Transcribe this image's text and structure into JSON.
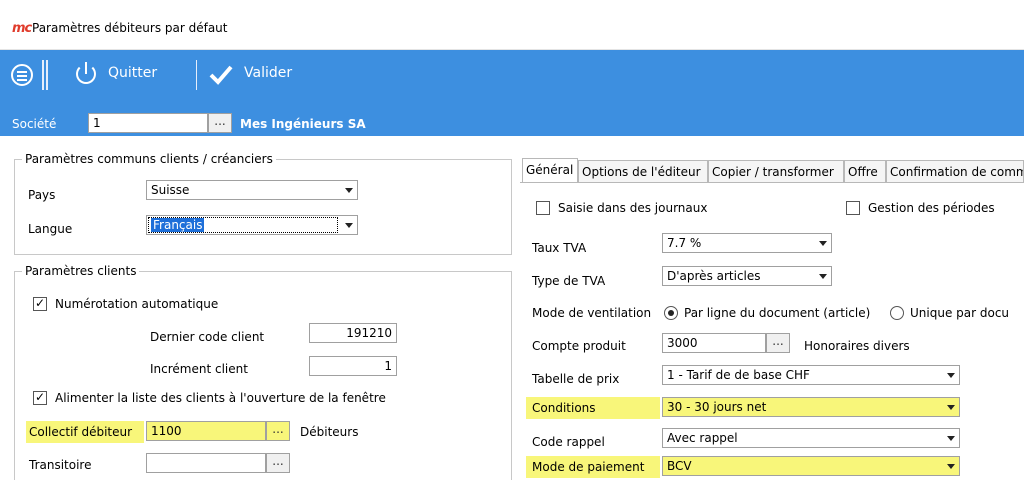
{
  "window": {
    "logo": "mc",
    "title": "Paramètres débiteurs par défaut"
  },
  "toolbar": {
    "quit_label": "Quitter",
    "validate_label": "Valider"
  },
  "societe": {
    "label": "Société",
    "value": "1",
    "browse": "...",
    "name": "Mes Ingénieurs SA"
  },
  "common": {
    "legend": "Paramètres communs clients / créanciers",
    "pays_label": "Pays",
    "pays_value": "Suisse",
    "langue_label": "Langue",
    "langue_value": "Français"
  },
  "clients": {
    "legend": "Paramètres clients",
    "auto_num_label": "Numérotation automatique",
    "dernier_label": "Dernier code client",
    "dernier_value": "191210",
    "increment_label": "Incrément client",
    "increment_value": "1",
    "alimenter_label": "Alimenter la liste des clients à l'ouverture de la fenêtre",
    "collectif_label": "Collectif débiteur",
    "collectif_value": "1100",
    "collectif_browse": "...",
    "collectif_name": "Débiteurs",
    "transitoire_label": "Transitoire",
    "transitoire_value": "",
    "transitoire_browse": "..."
  },
  "tabs": [
    "Général",
    "Options de l'éditeur",
    "Copier / transformer",
    "Offre",
    "Confirmation de comm"
  ],
  "general": {
    "saisie_label": "Saisie dans des journaux",
    "gestion_label": "Gestion des périodes",
    "taux_label": "Taux TVA",
    "taux_value": "7.7 %",
    "type_label": "Type de TVA",
    "type_value": "D'après articles",
    "mode_vent_label": "Mode de ventilation",
    "mode_vent_opt1": "Par ligne du document (article)",
    "mode_vent_opt2": "Unique par docu",
    "compte_label": "Compte produit",
    "compte_value": "3000",
    "compte_browse": "...",
    "compte_name": "Honoraires divers",
    "tabelle_label": "Tabelle de prix",
    "tabelle_value": "1 - Tarif de de base CHF",
    "conditions_label": "Conditions",
    "conditions_value": "30 - 30 jours net",
    "rappel_label": "Code rappel",
    "rappel_value": "Avec rappel",
    "paiement_label": "Mode de paiement",
    "paiement_value": "BCV"
  },
  "colors": {
    "toolbar": "#3d8fe0",
    "highlight": "#f8f67a",
    "selection": "#1e6fd9"
  }
}
